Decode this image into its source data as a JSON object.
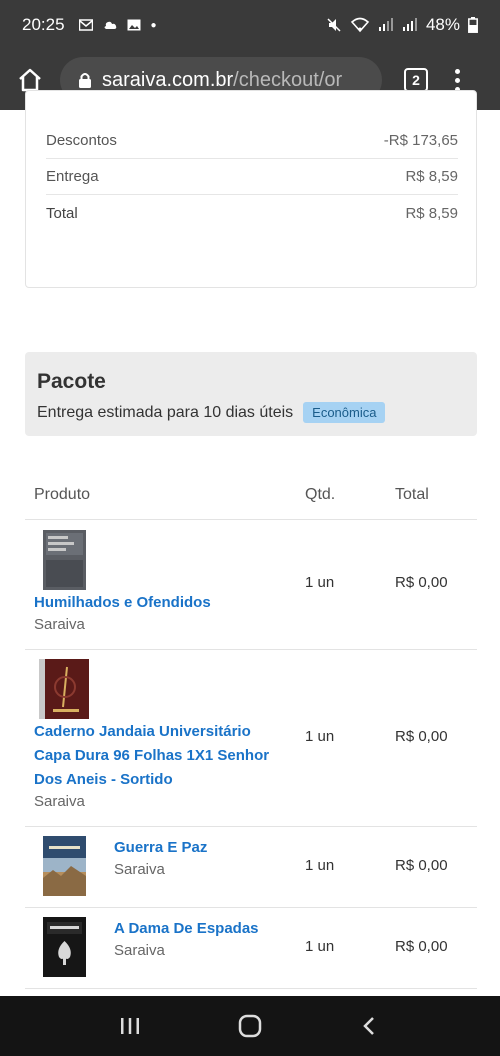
{
  "status_bar": {
    "time": "20:25",
    "battery": "48%"
  },
  "browser": {
    "url_host": "saraiva.com.br",
    "url_path": "/checkout/or",
    "tab_count": "2"
  },
  "summary": {
    "rows": [
      {
        "label": "Descontos",
        "value": "-R$ 173,65"
      },
      {
        "label": "Entrega",
        "value": "R$ 8,59"
      },
      {
        "label": "Total",
        "value": "R$ 8,59"
      }
    ]
  },
  "package": {
    "title": "Pacote",
    "delivery": "Entrega estimada para 10 dias úteis",
    "badge": "Econômica"
  },
  "table": {
    "headers": {
      "product": "Produto",
      "qty": "Qtd.",
      "total": "Total"
    },
    "rows": [
      {
        "name": "Humilhados e Ofendidos",
        "seller": "Saraiva",
        "qty": "1 un",
        "total": "R$ 0,00"
      },
      {
        "name": "Caderno Jandaia Universitário Capa Dura 96 Folhas 1X1 Senhor Dos Aneis - Sortido",
        "seller": "Saraiva",
        "qty": "1 un",
        "total": "R$ 0,00"
      },
      {
        "name": "Guerra E Paz",
        "seller": "Saraiva",
        "qty": "1 un",
        "total": "R$ 0,00"
      },
      {
        "name": "A Dama De Espadas",
        "seller": "Saraiva",
        "qty": "1 un",
        "total": "R$ 0,00"
      }
    ]
  },
  "colors": {
    "link": "#1a73c8",
    "badge_bg": "#a6d2f3",
    "chrome_bar": "#3a3a3a"
  }
}
